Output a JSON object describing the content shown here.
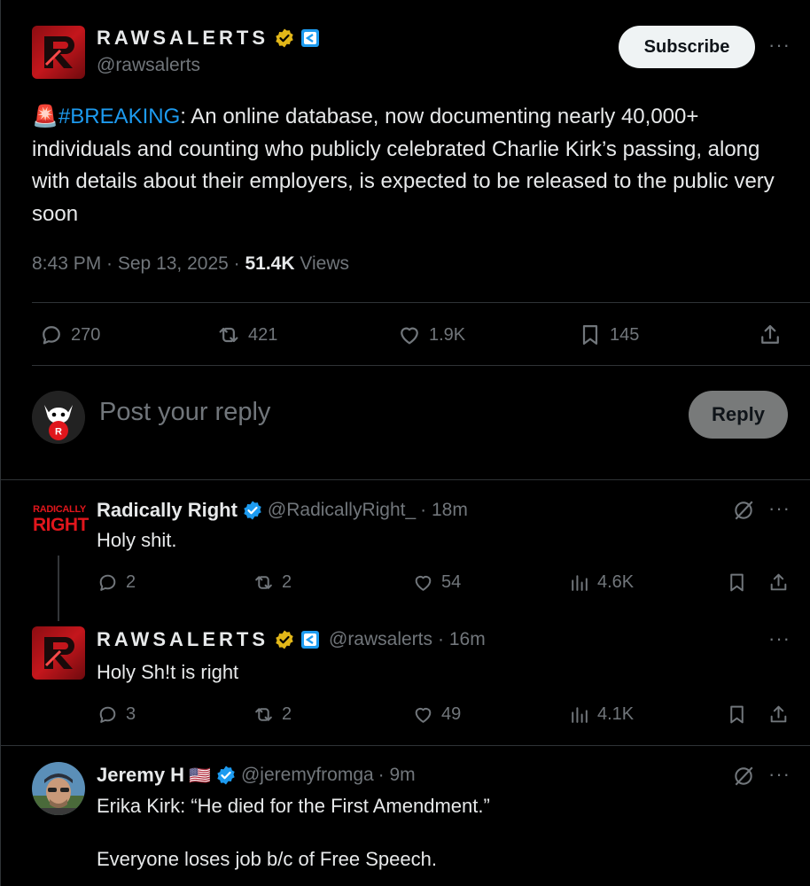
{
  "post": {
    "author_name": "RAWSALERTS",
    "author_handle": "@rawsalerts",
    "subscribe_label": "Subscribe",
    "more_label": "···",
    "alert_emoji": "🚨",
    "hashtag": "#BREAKING",
    "text": ": An online database, now documenting nearly 40,000+ individuals and counting who publicly celebrated Charlie Kirk’s passing, along with details about their employers, is expected to be released to the public very soon",
    "time": "8:43 PM · Sep 13, 2025 · ",
    "views_count": "51.4K",
    "views_label": " Views",
    "replies": "270",
    "reposts": "421",
    "likes": "1.9K",
    "bookmarks": "145"
  },
  "composer": {
    "placeholder": "Post your reply",
    "reply_label": "Reply"
  },
  "replies": [
    {
      "avatar_line1": "RADICALLY",
      "avatar_line2": "RIGHT",
      "name": "Radically Right",
      "handle": "@RadicallyRight_",
      "time": " · 18m",
      "text": "Holy shit.",
      "replies": "2",
      "reposts": "2",
      "likes": "54",
      "views": "4.6K"
    },
    {
      "name": "RAWSALERTS",
      "handle": "@rawsalerts",
      "time": " · 16m",
      "text": "Holy Sh!t is right",
      "replies": "3",
      "reposts": "2",
      "likes": "49",
      "views": "4.1K"
    },
    {
      "name": "Jeremy H",
      "flag": "🇺🇸",
      "handle": "@jeremyfromga",
      "time": " · 9m",
      "text_line1": "Erika Kirk: “He died for the First Amendment.”",
      "text_line2": "Everyone loses job b/c of Free Speech."
    }
  ],
  "colors": {
    "background": "#000000",
    "text": "#e7e9ea",
    "muted": "#71767b",
    "link": "#1d9bf0",
    "gold_badge": "#e2b719",
    "blue_badge": "#1d9bf0"
  }
}
